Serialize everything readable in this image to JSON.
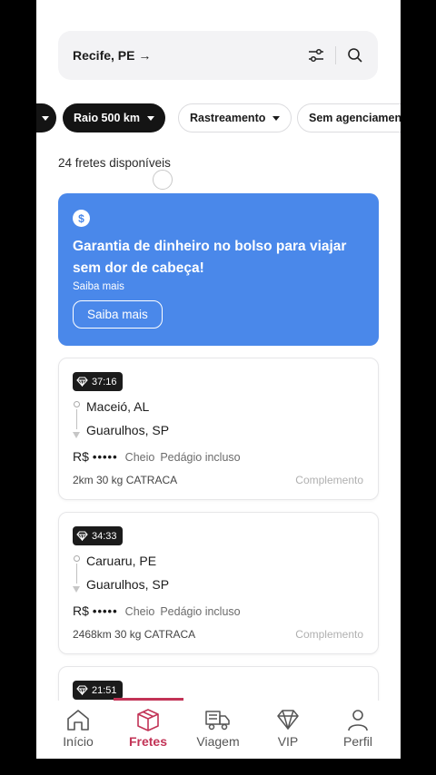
{
  "search": {
    "location": "Recife, PE →",
    "filter_icon": "sliders-icon",
    "search_icon": "search-icon"
  },
  "chips": [
    {
      "label": "",
      "style": "dark"
    },
    {
      "label": "Raio 500 km",
      "style": "dark"
    },
    {
      "label": "Rastreamento",
      "style": "light"
    },
    {
      "label": "Sem agenciamento",
      "style": "light"
    }
  ],
  "count_text": "24 fretes disponíveis",
  "banner": {
    "icon": "dollar-icon",
    "headline": "Garantia de dinheiro no bolso para viajar sem dor de cabeça!",
    "sub": "Saiba mais",
    "button": "Saiba mais",
    "color": "#4a88ea"
  },
  "cards": [
    {
      "timer": "37:16",
      "origin": "Maceió, AL",
      "destination": "Guarulhos, SP",
      "currency": "R$",
      "price_mask": "•••••",
      "load": "Cheio",
      "toll": "Pedágio incluso",
      "details": "2km 30 kg CATRACA",
      "complement": "Complemento"
    },
    {
      "timer": "34:33",
      "origin": "Caruaru, PE",
      "destination": "Guarulhos, SP",
      "currency": "R$",
      "price_mask": "•••••",
      "load": "Cheio",
      "toll": "Pedágio incluso",
      "details": "2468km 30 kg CATRACA",
      "complement": "Complemento"
    },
    {
      "timer": "21:51"
    }
  ],
  "nav": {
    "items": [
      {
        "label": "Início",
        "icon": "home-icon"
      },
      {
        "label": "Fretes",
        "icon": "box-icon",
        "active": true
      },
      {
        "label": "Viagem",
        "icon": "truck-icon"
      },
      {
        "label": "VIP",
        "icon": "diamond-icon"
      },
      {
        "label": "Perfil",
        "icon": "person-icon"
      }
    ],
    "active_color": "#c23356"
  }
}
